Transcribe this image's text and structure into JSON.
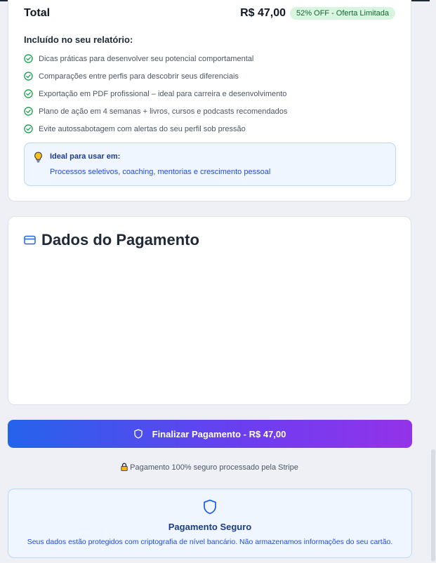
{
  "summary": {
    "total_label": "Total",
    "price": "R$ 47,00",
    "discount_badge": "52% OFF - Oferta Limitada",
    "included_title": "Incluído no seu relatório:",
    "features": [
      "Dicas práticas para desenvolver seu potencial comportamental",
      "Comparações entre perfis para descobrir seus diferenciais",
      "Exportação em PDF profissional – ideal para carreira e desenvolvimento",
      "Plano de ação em 4 semanas + livros, cursos e podcasts recomendados",
      "Evite autossabotagem com alertas do seu perfil sob pressão"
    ],
    "ideal_title": "Ideal para usar em:",
    "ideal_text": "Processos seletivos, coaching, mentorias e crescimento pessoal"
  },
  "payment": {
    "title": "Dados do Pagamento"
  },
  "submit": {
    "label": "Finalizar Pagamento - R$ 47,00"
  },
  "secure_note": "Pagamento 100% seguro processado pela Stripe",
  "secure_box": {
    "title": "Pagamento Seguro",
    "description": "Seus dados estão protegidos com criptografia de nível bancário. Não armazenamos informações do seu cartão."
  },
  "icons": {
    "check": "check-circle-icon",
    "bulb": "lightbulb-icon",
    "card": "credit-card-icon",
    "shield": "shield-icon",
    "lock": "lock-icon"
  },
  "colors": {
    "accent_start": "#2563eb",
    "accent_end": "#9333ea",
    "success": "#16a34a",
    "badge_bg": "#d8f5e0",
    "info_bg": "#eff6ff",
    "info_text": "#1d4ed8"
  }
}
